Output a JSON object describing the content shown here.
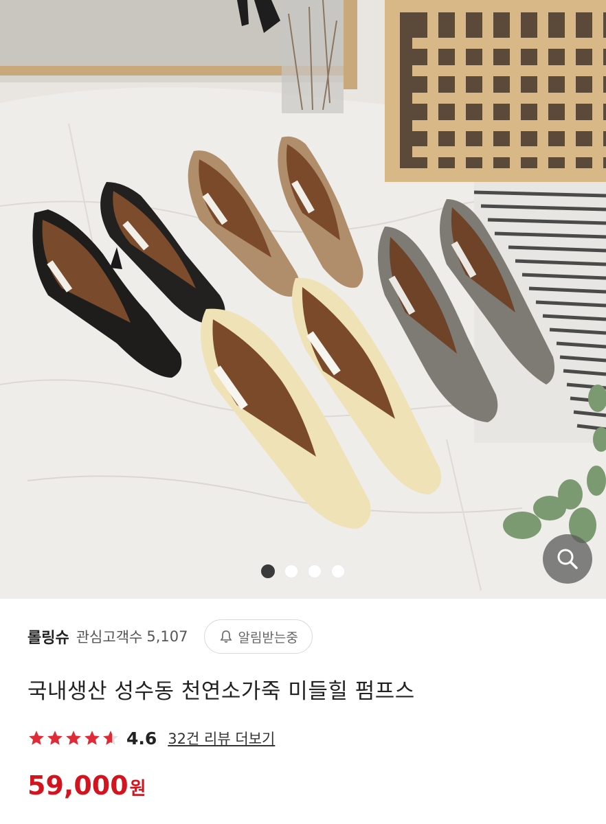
{
  "hero": {
    "image_alt": "product-photo-shoes",
    "dots": [
      {
        "active": true
      },
      {
        "active": false
      },
      {
        "active": false
      },
      {
        "active": false
      }
    ],
    "zoom_icon": "search-icon"
  },
  "store": {
    "name": "롤링슈",
    "fans_label": "관심고객수",
    "fans_count": "5,107",
    "alarm_label": "알림받는중",
    "alarm_icon": "bell-icon"
  },
  "product": {
    "title": "국내생산 성수동 천연소가죽 미들힐 펌프스",
    "rating": 4.6,
    "rating_text": "4.6",
    "review_link": "32건 리뷰 더보기",
    "price": "59,000",
    "currency": "원"
  },
  "colors": {
    "price": "#d3141f",
    "star": "#e02a36"
  }
}
